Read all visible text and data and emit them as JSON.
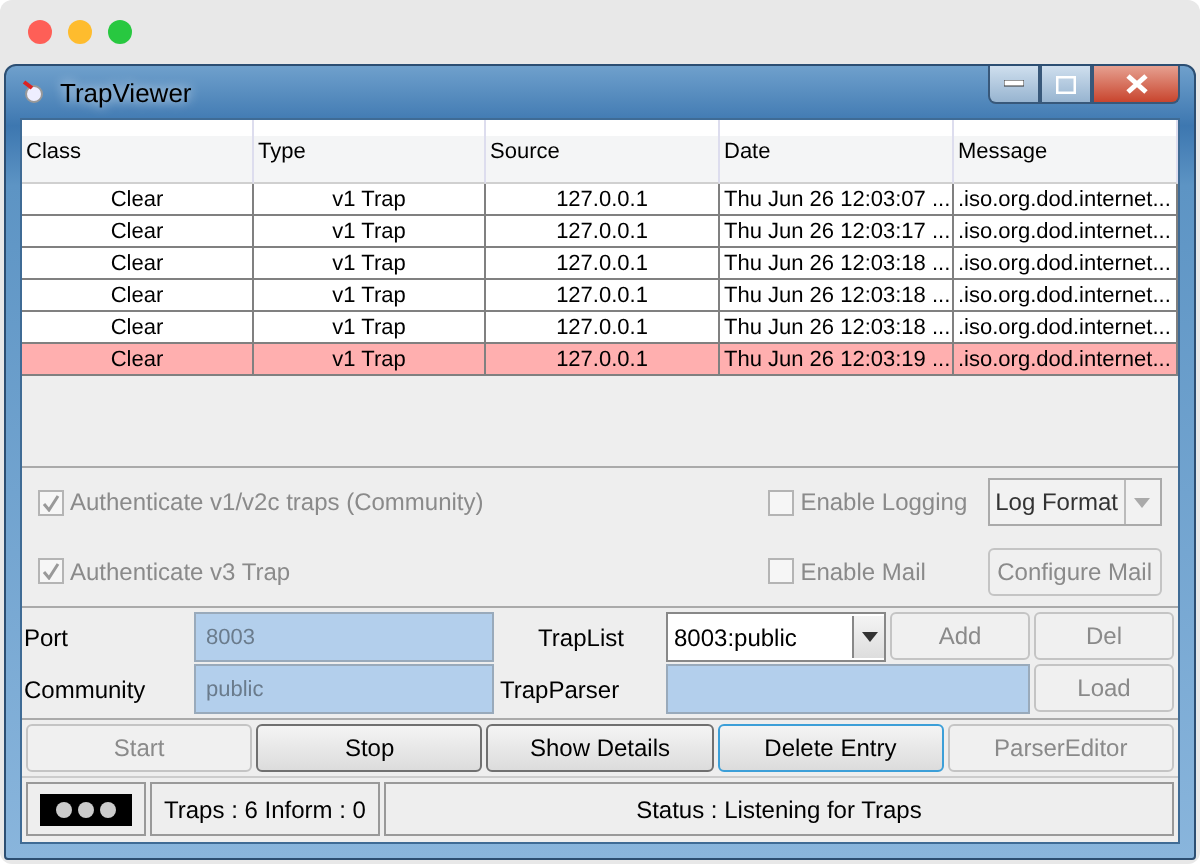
{
  "window": {
    "title": "TrapViewer"
  },
  "table": {
    "columns": [
      "Class",
      "Type",
      "Source",
      "Date",
      "Message"
    ],
    "rows": [
      {
        "cells": [
          "Clear",
          "v1 Trap",
          "127.0.0.1",
          "Thu Jun 26 12:03:07 ...",
          ".iso.org.dod.internet..."
        ],
        "selected": false
      },
      {
        "cells": [
          "Clear",
          "v1 Trap",
          "127.0.0.1",
          "Thu Jun 26 12:03:17 ...",
          ".iso.org.dod.internet..."
        ],
        "selected": false
      },
      {
        "cells": [
          "Clear",
          "v1 Trap",
          "127.0.0.1",
          "Thu Jun 26 12:03:18 ...",
          ".iso.org.dod.internet..."
        ],
        "selected": false
      },
      {
        "cells": [
          "Clear",
          "v1 Trap",
          "127.0.0.1",
          "Thu Jun 26 12:03:18 ...",
          ".iso.org.dod.internet..."
        ],
        "selected": false
      },
      {
        "cells": [
          "Clear",
          "v1 Trap",
          "127.0.0.1",
          "Thu Jun 26 12:03:18 ...",
          ".iso.org.dod.internet..."
        ],
        "selected": false
      },
      {
        "cells": [
          "Clear",
          "v1 Trap",
          "127.0.0.1",
          "Thu Jun 26 12:03:19 ...",
          ".iso.org.dod.internet..."
        ],
        "selected": true
      }
    ]
  },
  "options": {
    "auth_v1": {
      "label": "Authenticate v1/v2c traps (Community)",
      "checked": true,
      "disabled": true
    },
    "auth_v3": {
      "label": "Authenticate v3 Trap",
      "checked": true,
      "disabled": true
    },
    "logging": {
      "label": "Enable Logging",
      "checked": false,
      "disabled": true
    },
    "log_format": {
      "value": "Log Format",
      "disabled": true
    },
    "mail": {
      "label": "Enable Mail",
      "checked": false,
      "disabled": true
    },
    "configure_mail": {
      "label": "Configure Mail",
      "disabled": true
    }
  },
  "form": {
    "port_label": "Port",
    "port": "8003",
    "community_label": "Community",
    "community": "public",
    "traplist_label": "TrapList",
    "traplist": "8003:public",
    "trapparser_label": "TrapParser",
    "add": {
      "label": "Add",
      "disabled": true
    },
    "del": {
      "label": "Del",
      "disabled": true
    },
    "load": {
      "label": "Load",
      "disabled": true
    }
  },
  "buttons": [
    {
      "label": "Start",
      "disabled": true,
      "focused": false
    },
    {
      "label": "Stop",
      "disabled": false,
      "focused": false
    },
    {
      "label": "Show Details",
      "disabled": false,
      "focused": false
    },
    {
      "label": "Delete Entry",
      "disabled": false,
      "focused": true
    },
    {
      "label": "ParserEditor",
      "disabled": true,
      "focused": false
    }
  ],
  "status_bar": {
    "counts": "Traps  : 6 Inform  : 0",
    "status": "Status : Listening for Traps"
  }
}
